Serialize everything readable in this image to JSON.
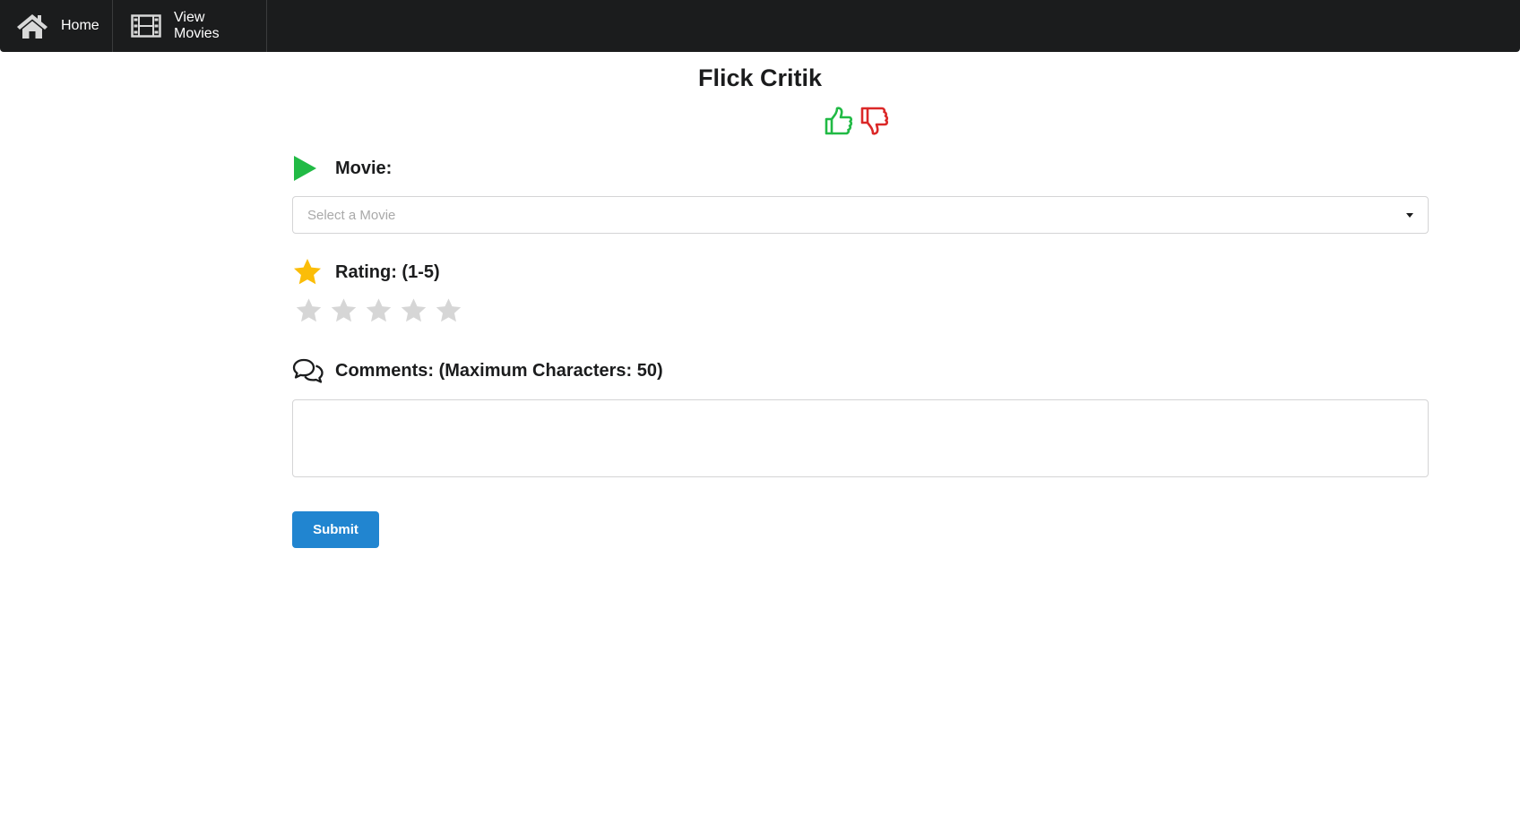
{
  "nav": {
    "home_label": "Home",
    "movies_label": "View Movies",
    "home_icon": "home-icon",
    "movies_icon": "film-icon"
  },
  "header": {
    "title": "Flick Critik",
    "like_icon": "thumbs-up-icon",
    "dislike_icon": "thumbs-down-icon"
  },
  "form": {
    "movie_label": "Movie:",
    "movie_placeholder": "Select a Movie",
    "rating_label": "Rating: (1-5)",
    "rating_value": 0,
    "rating_max": 5,
    "comments_label": "Comments: (Maximum Characters: 50)",
    "comments_value": "",
    "submit_label": "Submit"
  },
  "colors": {
    "navbar": "#1b1c1d",
    "play_icon": "#21ba45",
    "rating_icon": "#fbbd08",
    "star_empty": "#d6d6d6",
    "thumb_up": "#21ba45",
    "thumb_down": "#db2828",
    "submit": "#2185d0"
  }
}
